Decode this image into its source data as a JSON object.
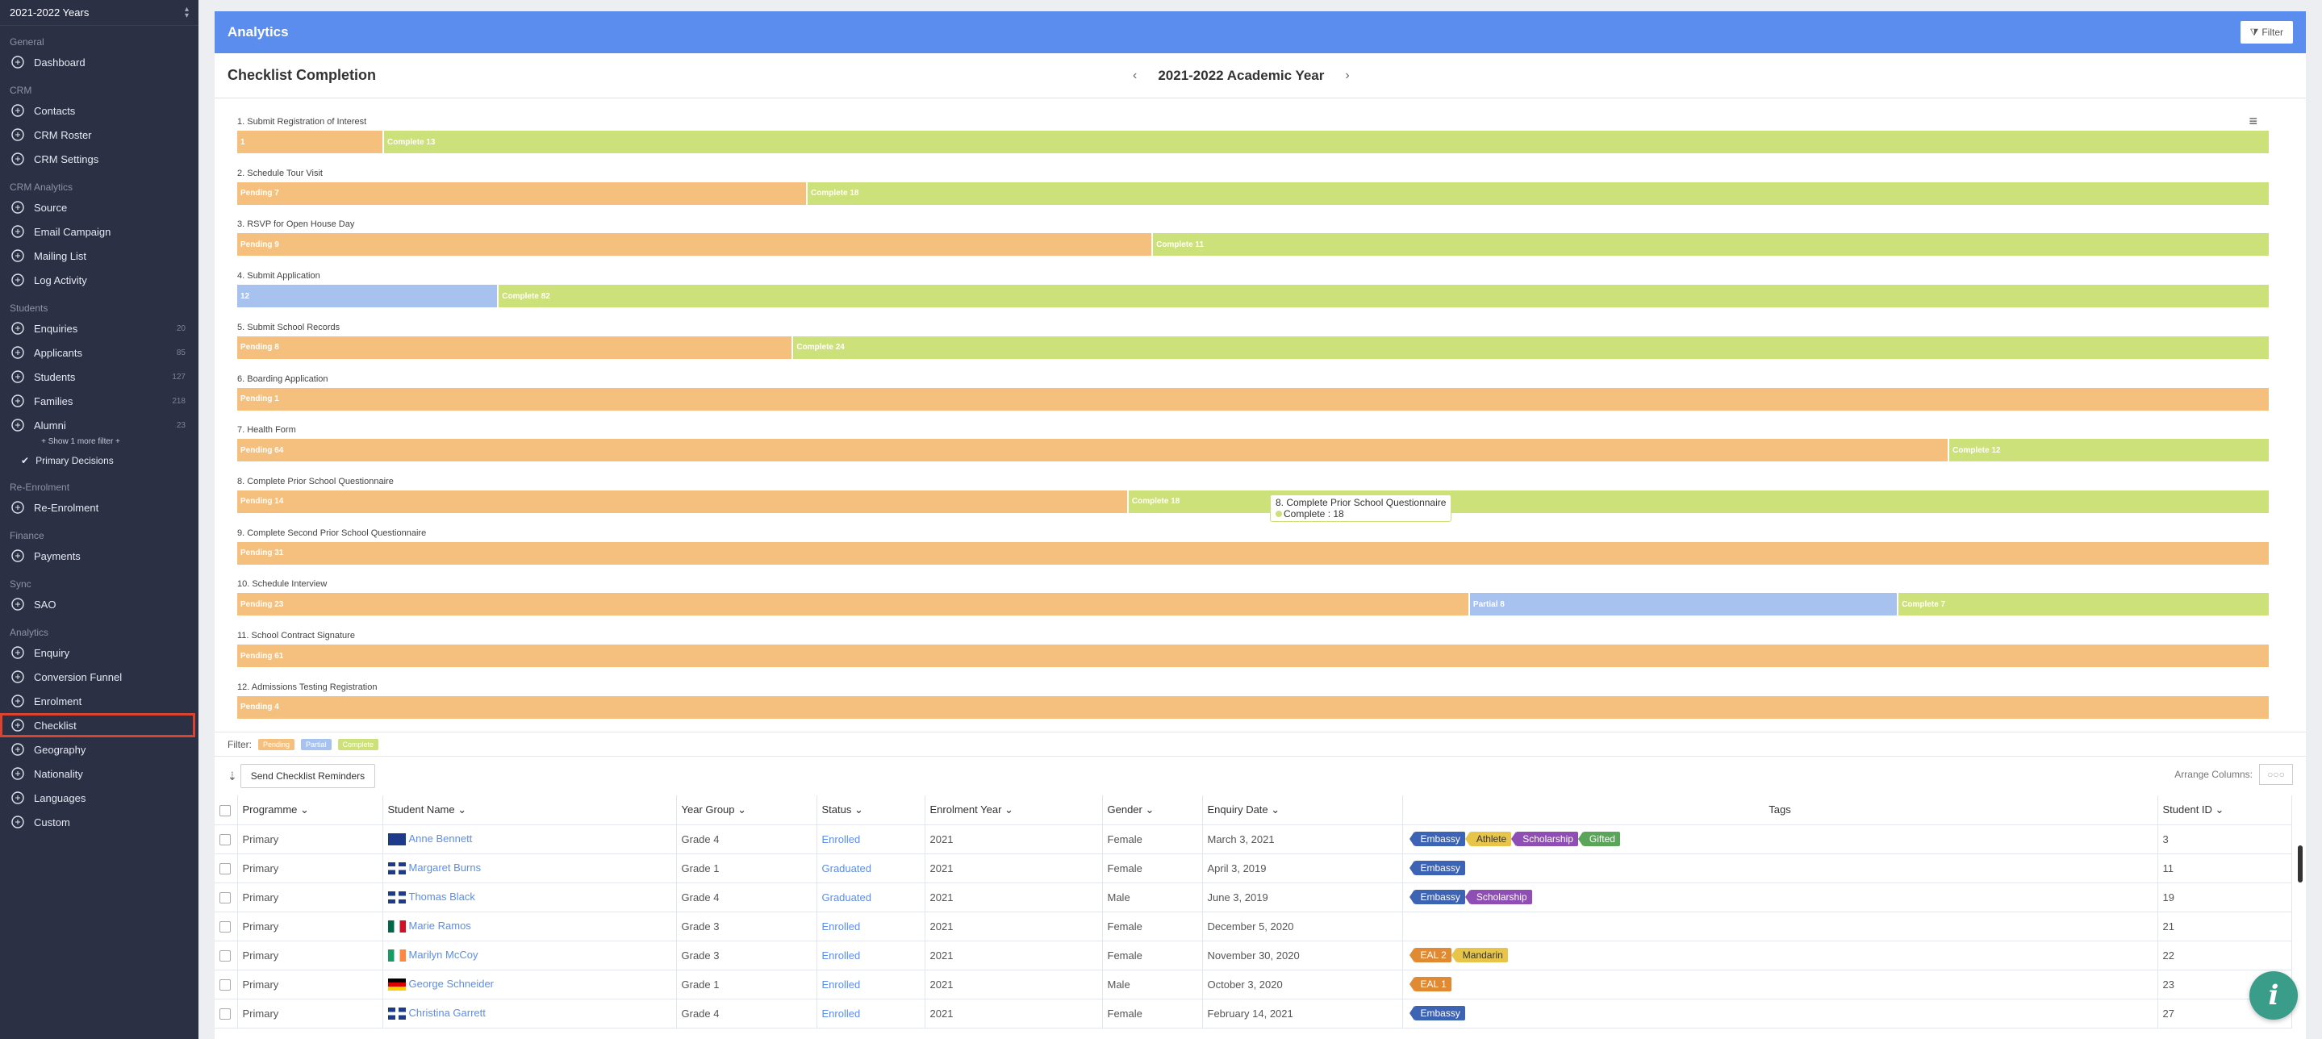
{
  "sidebar": {
    "year_select": "2021-2022 Years",
    "sections": [
      {
        "title": "General",
        "items": [
          {
            "label": "Dashboard",
            "icon": "dashboard-icon"
          }
        ]
      },
      {
        "title": "CRM",
        "items": [
          {
            "label": "Contacts",
            "icon": "contacts-icon"
          },
          {
            "label": "CRM Roster",
            "icon": "roster-icon"
          },
          {
            "label": "CRM Settings",
            "icon": "gear-icon"
          }
        ]
      },
      {
        "title": "CRM Analytics",
        "items": [
          {
            "label": "Source",
            "icon": "source-icon"
          },
          {
            "label": "Email Campaign",
            "icon": "megaphone-icon"
          },
          {
            "label": "Mailing List",
            "icon": "mail-icon"
          },
          {
            "label": "Log Activity",
            "icon": "log-icon"
          }
        ]
      },
      {
        "title": "Students",
        "items": [
          {
            "label": "Enquiries",
            "icon": "enquiry-icon",
            "count": "20"
          },
          {
            "label": "Applicants",
            "icon": "applicant-icon",
            "count": "85"
          },
          {
            "label": "Students",
            "icon": "student-icon",
            "count": "127"
          },
          {
            "label": "Families",
            "icon": "family-icon",
            "count": "218"
          },
          {
            "label": "Alumni",
            "icon": "graduation-cap-icon",
            "count": "23"
          }
        ]
      },
      {
        "title": "Re-Enrolment",
        "items": [
          {
            "label": "Re-Enrolment",
            "icon": "refresh-icon"
          }
        ]
      },
      {
        "title": "Finance",
        "items": [
          {
            "label": "Payments",
            "icon": "payment-icon"
          }
        ]
      },
      {
        "title": "Sync",
        "items": [
          {
            "label": "SAO",
            "icon": "sync-icon"
          }
        ]
      },
      {
        "title": "Analytics",
        "items": [
          {
            "label": "Enquiry",
            "icon": "analytics-icon"
          },
          {
            "label": "Conversion Funnel",
            "icon": "analytics-icon"
          },
          {
            "label": "Enrolment",
            "icon": "analytics-icon"
          },
          {
            "label": "Checklist",
            "icon": "checklist-icon"
          },
          {
            "label": "Geography",
            "icon": "globe-icon"
          },
          {
            "label": "Nationality",
            "icon": "globe-icon"
          },
          {
            "label": "Languages",
            "icon": "language-icon"
          },
          {
            "label": "Custom",
            "icon": "custom-icon"
          }
        ]
      }
    ],
    "show_more": "+ Show 1 more filter +",
    "primary_decisions": "Primary Decisions"
  },
  "header": {
    "title": "Analytics",
    "filter_label": "Filter",
    "page_title": "Checklist Completion",
    "year": "2021-2022 Academic Year"
  },
  "chart_data": {
    "type": "bar",
    "orientation": "horizontal-stacked",
    "rows": [
      {
        "label": "1. Submit Registration of Interest",
        "segments": [
          {
            "type": "pending",
            "text": "1",
            "value": 1
          },
          {
            "type": "complete",
            "text": "Complete  13",
            "value": 13
          }
        ]
      },
      {
        "label": "2. Schedule Tour Visit",
        "segments": [
          {
            "type": "pending",
            "text": "Pending  7",
            "value": 7
          },
          {
            "type": "complete",
            "text": "Complete  18",
            "value": 18
          }
        ]
      },
      {
        "label": "3. RSVP for Open House Day",
        "segments": [
          {
            "type": "pending",
            "text": "Pending  9",
            "value": 9
          },
          {
            "type": "complete",
            "text": "Complete  11",
            "value": 11
          }
        ]
      },
      {
        "label": "4. Submit Application",
        "segments": [
          {
            "type": "partial",
            "text": "12",
            "value": 12
          },
          {
            "type": "complete",
            "text": "Complete  82",
            "value": 82
          }
        ]
      },
      {
        "label": "5. Submit School Records",
        "segments": [
          {
            "type": "pending",
            "text": "Pending  8",
            "value": 8
          },
          {
            "type": "complete",
            "text": "Complete  24",
            "value": 24
          }
        ]
      },
      {
        "label": "6. Boarding Application",
        "segments": [
          {
            "type": "pending",
            "text": "Pending  1",
            "value": 1
          }
        ]
      },
      {
        "label": "7. Health Form",
        "segments": [
          {
            "type": "pending",
            "text": "Pending  64",
            "value": 64
          },
          {
            "type": "complete",
            "text": "Complete  12",
            "value": 12
          }
        ]
      },
      {
        "label": "8. Complete Prior School Questionnaire",
        "segments": [
          {
            "type": "pending",
            "text": "Pending  14",
            "value": 14
          },
          {
            "type": "complete",
            "text": "Complete  18",
            "value": 18
          }
        ],
        "tooltip": {
          "title": "8. Complete Prior School Questionnaire",
          "text": "Complete : 18"
        }
      },
      {
        "label": "9. Complete Second Prior School Questionnaire",
        "segments": [
          {
            "type": "pending",
            "text": "Pending  31",
            "value": 31
          }
        ]
      },
      {
        "label": "10. Schedule Interview",
        "segments": [
          {
            "type": "pending",
            "text": "Pending  23",
            "value": 23
          },
          {
            "type": "partial",
            "text": "Partial  8",
            "value": 8
          },
          {
            "type": "complete",
            "text": "Complete  7",
            "value": 7
          }
        ]
      },
      {
        "label": "11. School Contract Signature",
        "segments": [
          {
            "type": "pending",
            "text": "Pending  61",
            "value": 61
          }
        ]
      },
      {
        "label": "12. Admissions Testing Registration",
        "segments": [
          {
            "type": "pending",
            "text": "Pending  4",
            "value": 4
          }
        ]
      }
    ],
    "colors": {
      "pending": "#f5c07d",
      "partial": "#a8c2f0",
      "complete": "#cde17a"
    }
  },
  "legend": {
    "label": "Filter:",
    "pending": "Pending",
    "partial": "Partial",
    "complete": "Complete"
  },
  "table": {
    "send_reminders": "Send Checklist Reminders",
    "arrange_columns": "Arrange Columns:",
    "columns": [
      "Programme",
      "Student Name",
      "Year Group",
      "Status",
      "Enrolment Year",
      "Gender",
      "Enquiry Date",
      "Tags",
      "Student ID"
    ],
    "rows": [
      {
        "programme": "Primary",
        "name": "Anne Bennett",
        "flag": "au",
        "year_group": "Grade 4",
        "status": "Enrolled",
        "enrol_year": "2021",
        "gender": "Female",
        "enquiry_date": "March 3, 2021",
        "tags": [
          "Embassy",
          "Athlete",
          "Scholarship",
          "Gifted"
        ],
        "id": "3"
      },
      {
        "programme": "Primary",
        "name": "Margaret Burns",
        "flag": "gb",
        "year_group": "Grade 1",
        "status": "Graduated",
        "enrol_year": "2021",
        "gender": "Female",
        "enquiry_date": "April 3, 2019",
        "tags": [
          "Embassy"
        ],
        "id": "11"
      },
      {
        "programme": "Primary",
        "name": "Thomas Black",
        "flag": "gb",
        "year_group": "Grade 4",
        "status": "Graduated",
        "enrol_year": "2021",
        "gender": "Male",
        "enquiry_date": "June 3, 2019",
        "tags": [
          "Embassy",
          "Scholarship"
        ],
        "id": "19"
      },
      {
        "programme": "Primary",
        "name": "Marie Ramos",
        "flag": "mx",
        "year_group": "Grade 3",
        "status": "Enrolled",
        "enrol_year": "2021",
        "gender": "Female",
        "enquiry_date": "December 5, 2020",
        "tags": [],
        "id": "21"
      },
      {
        "programme": "Primary",
        "name": "Marilyn McCoy",
        "flag": "ie",
        "year_group": "Grade 3",
        "status": "Enrolled",
        "enrol_year": "2021",
        "gender": "Female",
        "enquiry_date": "November 30, 2020",
        "tags": [
          "EAL 2",
          "Mandarin"
        ],
        "id": "22"
      },
      {
        "programme": "Primary",
        "name": "George Schneider",
        "flag": "de",
        "year_group": "Grade 1",
        "status": "Enrolled",
        "enrol_year": "2021",
        "gender": "Male",
        "enquiry_date": "October 3, 2020",
        "tags": [
          "EAL 1"
        ],
        "id": "23"
      },
      {
        "programme": "Primary",
        "name": "Christina Garrett",
        "flag": "gb",
        "year_group": "Grade 4",
        "status": "Enrolled",
        "enrol_year": "2021",
        "gender": "Female",
        "enquiry_date": "February 14, 2021",
        "tags": [
          "Embassy"
        ],
        "id": "27"
      }
    ],
    "tag_colors": {
      "Embassy": "#3d63b5",
      "Athlete": "#e7c54a",
      "Scholarship": "#8e4eb3",
      "Gifted": "#5aa55a",
      "EAL 2": "#e08a34",
      "Mandarin": "#e7c54a",
      "EAL 1": "#e08a34"
    }
  }
}
